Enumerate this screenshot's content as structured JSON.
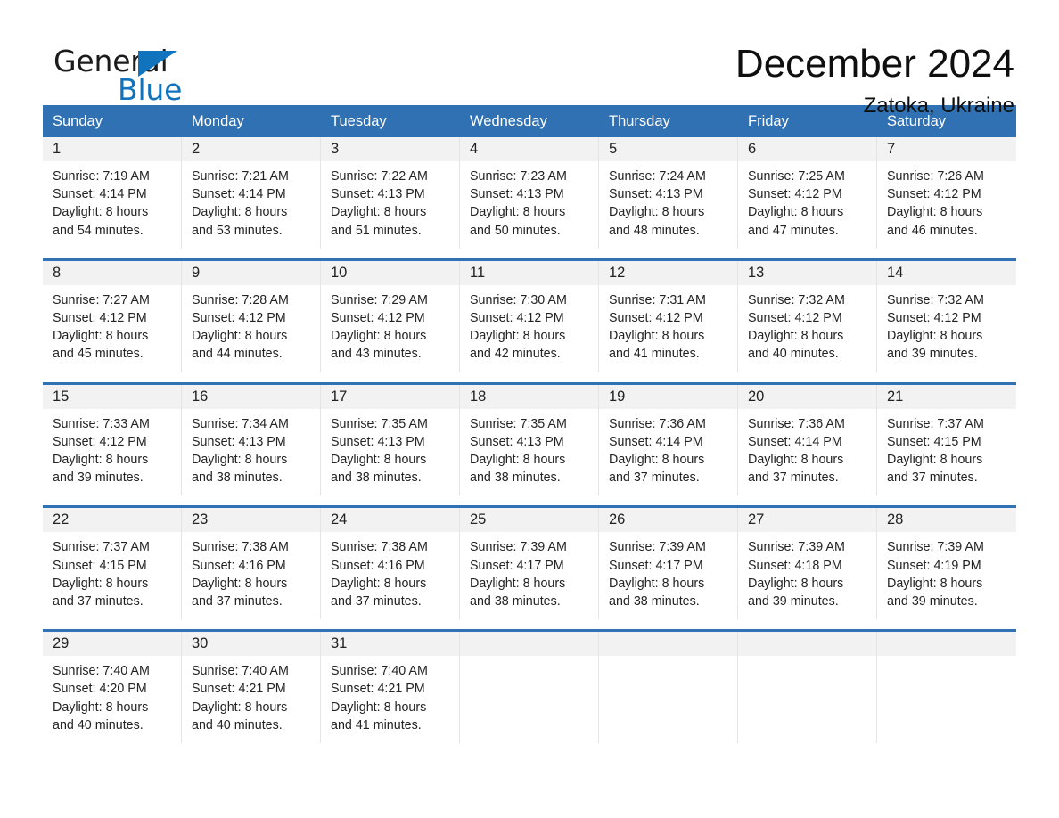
{
  "brand": {
    "name_top": "General",
    "name_bottom": "Blue",
    "accent_color": "#1273bd"
  },
  "header": {
    "month_title": "December 2024",
    "location": "Zatoka, Ukraine",
    "header_bg": "#3071b4",
    "row_divider_color": "#2f72b5",
    "daynum_band_bg": "#f2f2f2"
  },
  "weekdays": [
    "Sunday",
    "Monday",
    "Tuesday",
    "Wednesday",
    "Thursday",
    "Friday",
    "Saturday"
  ],
  "weeks": [
    {
      "days": [
        {
          "num": "1",
          "sunrise": "Sunrise: 7:19 AM",
          "sunset": "Sunset: 4:14 PM",
          "daylight1": "Daylight: 8 hours",
          "daylight2": "and 54 minutes."
        },
        {
          "num": "2",
          "sunrise": "Sunrise: 7:21 AM",
          "sunset": "Sunset: 4:14 PM",
          "daylight1": "Daylight: 8 hours",
          "daylight2": "and 53 minutes."
        },
        {
          "num": "3",
          "sunrise": "Sunrise: 7:22 AM",
          "sunset": "Sunset: 4:13 PM",
          "daylight1": "Daylight: 8 hours",
          "daylight2": "and 51 minutes."
        },
        {
          "num": "4",
          "sunrise": "Sunrise: 7:23 AM",
          "sunset": "Sunset: 4:13 PM",
          "daylight1": "Daylight: 8 hours",
          "daylight2": "and 50 minutes."
        },
        {
          "num": "5",
          "sunrise": "Sunrise: 7:24 AM",
          "sunset": "Sunset: 4:13 PM",
          "daylight1": "Daylight: 8 hours",
          "daylight2": "and 48 minutes."
        },
        {
          "num": "6",
          "sunrise": "Sunrise: 7:25 AM",
          "sunset": "Sunset: 4:12 PM",
          "daylight1": "Daylight: 8 hours",
          "daylight2": "and 47 minutes."
        },
        {
          "num": "7",
          "sunrise": "Sunrise: 7:26 AM",
          "sunset": "Sunset: 4:12 PM",
          "daylight1": "Daylight: 8 hours",
          "daylight2": "and 46 minutes."
        }
      ]
    },
    {
      "days": [
        {
          "num": "8",
          "sunrise": "Sunrise: 7:27 AM",
          "sunset": "Sunset: 4:12 PM",
          "daylight1": "Daylight: 8 hours",
          "daylight2": "and 45 minutes."
        },
        {
          "num": "9",
          "sunrise": "Sunrise: 7:28 AM",
          "sunset": "Sunset: 4:12 PM",
          "daylight1": "Daylight: 8 hours",
          "daylight2": "and 44 minutes."
        },
        {
          "num": "10",
          "sunrise": "Sunrise: 7:29 AM",
          "sunset": "Sunset: 4:12 PM",
          "daylight1": "Daylight: 8 hours",
          "daylight2": "and 43 minutes."
        },
        {
          "num": "11",
          "sunrise": "Sunrise: 7:30 AM",
          "sunset": "Sunset: 4:12 PM",
          "daylight1": "Daylight: 8 hours",
          "daylight2": "and 42 minutes."
        },
        {
          "num": "12",
          "sunrise": "Sunrise: 7:31 AM",
          "sunset": "Sunset: 4:12 PM",
          "daylight1": "Daylight: 8 hours",
          "daylight2": "and 41 minutes."
        },
        {
          "num": "13",
          "sunrise": "Sunrise: 7:32 AM",
          "sunset": "Sunset: 4:12 PM",
          "daylight1": "Daylight: 8 hours",
          "daylight2": "and 40 minutes."
        },
        {
          "num": "14",
          "sunrise": "Sunrise: 7:32 AM",
          "sunset": "Sunset: 4:12 PM",
          "daylight1": "Daylight: 8 hours",
          "daylight2": "and 39 minutes."
        }
      ]
    },
    {
      "days": [
        {
          "num": "15",
          "sunrise": "Sunrise: 7:33 AM",
          "sunset": "Sunset: 4:12 PM",
          "daylight1": "Daylight: 8 hours",
          "daylight2": "and 39 minutes."
        },
        {
          "num": "16",
          "sunrise": "Sunrise: 7:34 AM",
          "sunset": "Sunset: 4:13 PM",
          "daylight1": "Daylight: 8 hours",
          "daylight2": "and 38 minutes."
        },
        {
          "num": "17",
          "sunrise": "Sunrise: 7:35 AM",
          "sunset": "Sunset: 4:13 PM",
          "daylight1": "Daylight: 8 hours",
          "daylight2": "and 38 minutes."
        },
        {
          "num": "18",
          "sunrise": "Sunrise: 7:35 AM",
          "sunset": "Sunset: 4:13 PM",
          "daylight1": "Daylight: 8 hours",
          "daylight2": "and 38 minutes."
        },
        {
          "num": "19",
          "sunrise": "Sunrise: 7:36 AM",
          "sunset": "Sunset: 4:14 PM",
          "daylight1": "Daylight: 8 hours",
          "daylight2": "and 37 minutes."
        },
        {
          "num": "20",
          "sunrise": "Sunrise: 7:36 AM",
          "sunset": "Sunset: 4:14 PM",
          "daylight1": "Daylight: 8 hours",
          "daylight2": "and 37 minutes."
        },
        {
          "num": "21",
          "sunrise": "Sunrise: 7:37 AM",
          "sunset": "Sunset: 4:15 PM",
          "daylight1": "Daylight: 8 hours",
          "daylight2": "and 37 minutes."
        }
      ]
    },
    {
      "days": [
        {
          "num": "22",
          "sunrise": "Sunrise: 7:37 AM",
          "sunset": "Sunset: 4:15 PM",
          "daylight1": "Daylight: 8 hours",
          "daylight2": "and 37 minutes."
        },
        {
          "num": "23",
          "sunrise": "Sunrise: 7:38 AM",
          "sunset": "Sunset: 4:16 PM",
          "daylight1": "Daylight: 8 hours",
          "daylight2": "and 37 minutes."
        },
        {
          "num": "24",
          "sunrise": "Sunrise: 7:38 AM",
          "sunset": "Sunset: 4:16 PM",
          "daylight1": "Daylight: 8 hours",
          "daylight2": "and 37 minutes."
        },
        {
          "num": "25",
          "sunrise": "Sunrise: 7:39 AM",
          "sunset": "Sunset: 4:17 PM",
          "daylight1": "Daylight: 8 hours",
          "daylight2": "and 38 minutes."
        },
        {
          "num": "26",
          "sunrise": "Sunrise: 7:39 AM",
          "sunset": "Sunset: 4:17 PM",
          "daylight1": "Daylight: 8 hours",
          "daylight2": "and 38 minutes."
        },
        {
          "num": "27",
          "sunrise": "Sunrise: 7:39 AM",
          "sunset": "Sunset: 4:18 PM",
          "daylight1": "Daylight: 8 hours",
          "daylight2": "and 39 minutes."
        },
        {
          "num": "28",
          "sunrise": "Sunrise: 7:39 AM",
          "sunset": "Sunset: 4:19 PM",
          "daylight1": "Daylight: 8 hours",
          "daylight2": "and 39 minutes."
        }
      ]
    },
    {
      "days": [
        {
          "num": "29",
          "sunrise": "Sunrise: 7:40 AM",
          "sunset": "Sunset: 4:20 PM",
          "daylight1": "Daylight: 8 hours",
          "daylight2": "and 40 minutes."
        },
        {
          "num": "30",
          "sunrise": "Sunrise: 7:40 AM",
          "sunset": "Sunset: 4:21 PM",
          "daylight1": "Daylight: 8 hours",
          "daylight2": "and 40 minutes."
        },
        {
          "num": "31",
          "sunrise": "Sunrise: 7:40 AM",
          "sunset": "Sunset: 4:21 PM",
          "daylight1": "Daylight: 8 hours",
          "daylight2": "and 41 minutes."
        },
        {
          "num": "",
          "sunrise": "",
          "sunset": "",
          "daylight1": "",
          "daylight2": ""
        },
        {
          "num": "",
          "sunrise": "",
          "sunset": "",
          "daylight1": "",
          "daylight2": ""
        },
        {
          "num": "",
          "sunrise": "",
          "sunset": "",
          "daylight1": "",
          "daylight2": ""
        },
        {
          "num": "",
          "sunrise": "",
          "sunset": "",
          "daylight1": "",
          "daylight2": ""
        }
      ]
    }
  ]
}
